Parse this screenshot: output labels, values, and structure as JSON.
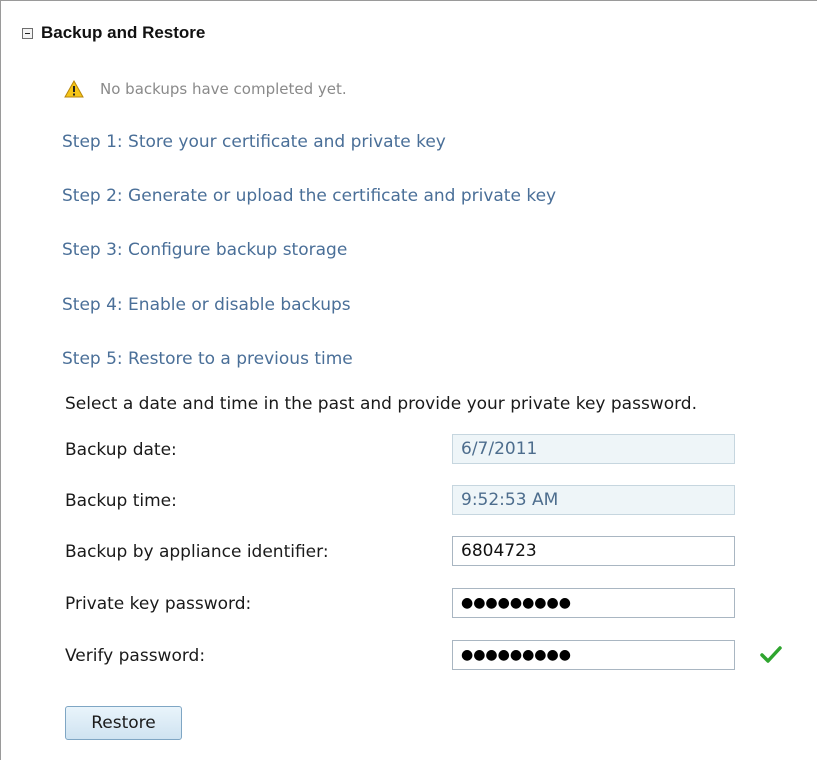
{
  "section": {
    "title": "Backup and Restore"
  },
  "warning": {
    "text": "No backups have completed yet.",
    "icon": "warning-icon"
  },
  "steps": [
    {
      "label": "Step 1: Store your certificate and private key"
    },
    {
      "label": "Step 2: Generate or upload the certificate and private key"
    },
    {
      "label": "Step 3: Configure backup storage"
    },
    {
      "label": "Step 4: Enable or disable backups"
    },
    {
      "label": "Step 5: Restore to a previous time"
    }
  ],
  "restore": {
    "instruction": "Select a date and time in the past and provide your private key password.",
    "fields": {
      "backup_date": {
        "label": "Backup date:",
        "value": "6/7/2011"
      },
      "backup_time": {
        "label": "Backup time:",
        "value": "9:52:53 AM"
      },
      "appliance_id": {
        "label": "Backup by appliance identifier:",
        "value": "6804723"
      },
      "private_key_password": {
        "label": "Private key password:",
        "value": "●●●●●●●●●"
      },
      "verify_password": {
        "label": "Verify password:",
        "value": "●●●●●●●●●"
      }
    },
    "button_label": "Restore"
  },
  "colors": {
    "link": "#4a6f98",
    "readonly_field_bg": "#eef5f8",
    "check_green": "#2fa52f",
    "warning_yellow": "#f5c518"
  }
}
